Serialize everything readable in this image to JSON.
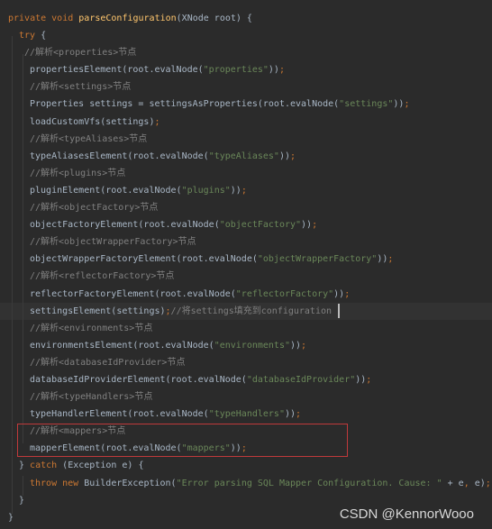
{
  "editor": {
    "colors": {
      "background": "#2b2b2b",
      "keyword": "#cc7832",
      "text": "#a9b7c6",
      "string": "#6a8759",
      "comment": "#808080",
      "method_decl": "#ffc66d",
      "highlight_box": "#c0393b"
    },
    "current_line": 17,
    "highlighted_lines": [
      24,
      25
    ],
    "lines": [
      {
        "indent": 9,
        "tokens": [
          {
            "t": "private void ",
            "c": "kw"
          },
          {
            "t": "parseConfiguration",
            "c": "fn"
          },
          {
            "t": "(XNode root) {",
            "c": "plain"
          }
        ]
      },
      {
        "indent": 21,
        "tokens": [
          {
            "t": "try ",
            "c": "kw"
          },
          {
            "t": "{",
            "c": "plain"
          }
        ]
      },
      {
        "indent": 27,
        "tokens": [
          {
            "t": "//解析<properties>节点",
            "c": "cmt"
          }
        ]
      },
      {
        "indent": 33,
        "tokens": [
          {
            "t": "propertiesElement(root.evalNode(",
            "c": "plain"
          },
          {
            "t": "\"properties\"",
            "c": "str"
          },
          {
            "t": "))",
            "c": "plain"
          },
          {
            "t": ";",
            "c": "kw"
          }
        ]
      },
      {
        "indent": 33,
        "tokens": [
          {
            "t": "//解析<settings>节点",
            "c": "cmt"
          }
        ]
      },
      {
        "indent": 33,
        "tokens": [
          {
            "t": "Properties settings = settingsAsProperties(root.evalNode(",
            "c": "plain"
          },
          {
            "t": "\"settings\"",
            "c": "str"
          },
          {
            "t": "))",
            "c": "plain"
          },
          {
            "t": ";",
            "c": "kw"
          }
        ]
      },
      {
        "indent": 33,
        "tokens": [
          {
            "t": "loadCustomVfs(settings)",
            "c": "plain"
          },
          {
            "t": ";",
            "c": "kw"
          }
        ]
      },
      {
        "indent": 33,
        "tokens": [
          {
            "t": "//解析<typeAliases>节点",
            "c": "cmt"
          }
        ]
      },
      {
        "indent": 33,
        "tokens": [
          {
            "t": "typeAliasesElement(root.evalNode(",
            "c": "plain"
          },
          {
            "t": "\"typeAliases\"",
            "c": "str"
          },
          {
            "t": "))",
            "c": "plain"
          },
          {
            "t": ";",
            "c": "kw"
          }
        ]
      },
      {
        "indent": 33,
        "tokens": [
          {
            "t": "//解析<plugins>节点",
            "c": "cmt"
          }
        ]
      },
      {
        "indent": 33,
        "tokens": [
          {
            "t": "pluginElement(root.evalNode(",
            "c": "plain"
          },
          {
            "t": "\"plugins\"",
            "c": "str"
          },
          {
            "t": "))",
            "c": "plain"
          },
          {
            "t": ";",
            "c": "kw"
          }
        ]
      },
      {
        "indent": 33,
        "tokens": [
          {
            "t": "//解析<objectFactory>节点",
            "c": "cmt"
          }
        ]
      },
      {
        "indent": 33,
        "tokens": [
          {
            "t": "objectFactoryElement(root.evalNode(",
            "c": "plain"
          },
          {
            "t": "\"objectFactory\"",
            "c": "str"
          },
          {
            "t": "))",
            "c": "plain"
          },
          {
            "t": ";",
            "c": "kw"
          }
        ]
      },
      {
        "indent": 33,
        "tokens": [
          {
            "t": "//解析<objectWrapperFactory>节点",
            "c": "cmt"
          }
        ]
      },
      {
        "indent": 33,
        "tokens": [
          {
            "t": "objectWrapperFactoryElement(root.evalNode(",
            "c": "plain"
          },
          {
            "t": "\"objectWrapperFactory\"",
            "c": "str"
          },
          {
            "t": "))",
            "c": "plain"
          },
          {
            "t": ";",
            "c": "kw"
          }
        ]
      },
      {
        "indent": 33,
        "tokens": [
          {
            "t": "//解析<reflectorFactory>节点",
            "c": "cmt"
          }
        ]
      },
      {
        "indent": 33,
        "tokens": [
          {
            "t": "reflectorFactoryElement(root.evalNode(",
            "c": "plain"
          },
          {
            "t": "\"reflectorFactory\"",
            "c": "str"
          },
          {
            "t": "))",
            "c": "plain"
          },
          {
            "t": ";",
            "c": "kw"
          }
        ]
      },
      {
        "indent": 33,
        "tokens": [
          {
            "t": "settingsElement(settings)",
            "c": "plain"
          },
          {
            "t": ";",
            "c": "kw"
          },
          {
            "t": "//将settings填充到configuration",
            "c": "cmt"
          }
        ]
      },
      {
        "indent": 33,
        "tokens": [
          {
            "t": "//解析<environments>节点",
            "c": "cmt"
          }
        ]
      },
      {
        "indent": 33,
        "tokens": [
          {
            "t": "environmentsElement(root.evalNode(",
            "c": "plain"
          },
          {
            "t": "\"environments\"",
            "c": "str"
          },
          {
            "t": "))",
            "c": "plain"
          },
          {
            "t": ";",
            "c": "kw"
          }
        ]
      },
      {
        "indent": 33,
        "tokens": [
          {
            "t": "//解析<databaseIdProvider>节点",
            "c": "cmt"
          }
        ]
      },
      {
        "indent": 33,
        "tokens": [
          {
            "t": "databaseIdProviderElement(root.evalNode(",
            "c": "plain"
          },
          {
            "t": "\"databaseIdProvider\"",
            "c": "str"
          },
          {
            "t": "))",
            "c": "plain"
          },
          {
            "t": ";",
            "c": "kw"
          }
        ]
      },
      {
        "indent": 33,
        "tokens": [
          {
            "t": "//解析<typeHandlers>节点",
            "c": "cmt"
          }
        ]
      },
      {
        "indent": 33,
        "tokens": [
          {
            "t": "typeHandlerElement(root.evalNode(",
            "c": "plain"
          },
          {
            "t": "\"typeHandlers\"",
            "c": "str"
          },
          {
            "t": "))",
            "c": "plain"
          },
          {
            "t": ";",
            "c": "kw"
          }
        ]
      },
      {
        "indent": 33,
        "tokens": [
          {
            "t": "//解析<mappers>节点",
            "c": "cmt"
          }
        ]
      },
      {
        "indent": 33,
        "tokens": [
          {
            "t": "mapperElement(root.evalNode(",
            "c": "plain"
          },
          {
            "t": "\"mappers\"",
            "c": "str"
          },
          {
            "t": "))",
            "c": "plain"
          },
          {
            "t": ";",
            "c": "kw"
          }
        ]
      },
      {
        "indent": 21,
        "tokens": [
          {
            "t": "} ",
            "c": "plain"
          },
          {
            "t": "catch ",
            "c": "kw"
          },
          {
            "t": "(Exception e) {",
            "c": "plain"
          }
        ]
      },
      {
        "indent": 33,
        "tokens": [
          {
            "t": "throw new ",
            "c": "kw"
          },
          {
            "t": "BuilderException(",
            "c": "plain"
          },
          {
            "t": "\"Error parsing SQL Mapper Configuration. Cause: \"",
            "c": "str"
          },
          {
            "t": " + e",
            "c": "plain"
          },
          {
            "t": ", ",
            "c": "kw"
          },
          {
            "t": "e)",
            "c": "plain"
          },
          {
            "t": ";",
            "c": "kw"
          }
        ]
      },
      {
        "indent": 21,
        "tokens": [
          {
            "t": "}",
            "c": "plain"
          }
        ]
      },
      {
        "indent": 9,
        "tokens": [
          {
            "t": "}",
            "c": "plain"
          }
        ]
      }
    ]
  },
  "watermark": "CSDN @KennorWooo"
}
